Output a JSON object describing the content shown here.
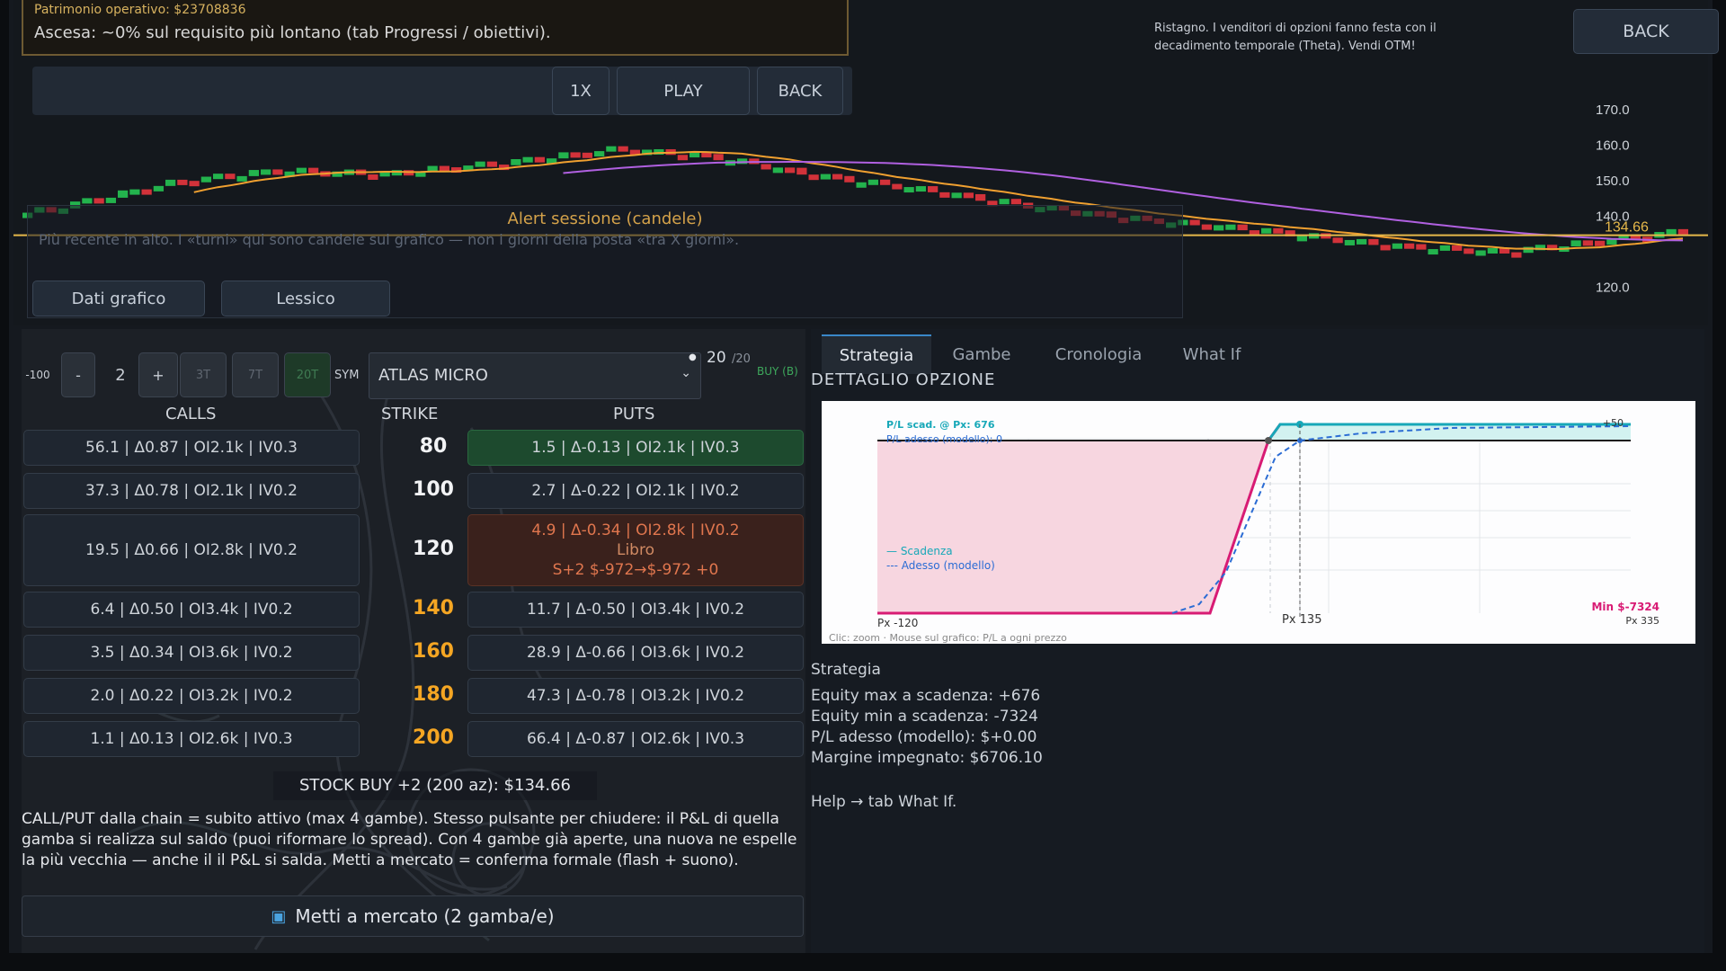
{
  "hud": {
    "patrimonio": "Patrimonio operativo: $23708836",
    "ascesa": "Ascesa: ~0% sul requisito più lontano (tab Progressi / obiettivi)."
  },
  "controls": {
    "speed": "1X",
    "play": "PLAY",
    "back": "BACK",
    "back_top": "BACK"
  },
  "note": "Ristagno. I venditori di opzioni fanno festa con il decadimento temporale (Theta). Vendi OTM!",
  "alert": {
    "title": "Alert sessione (candele)",
    "subtitle": "Più recente in alto. I «turni» qui sono candele sul grafico — non i giorni della posta «tra X giorni»."
  },
  "buttons": {
    "dati": "Dati grafico",
    "lessico": "Lessico"
  },
  "price_chart": {
    "price_tag": "134.66",
    "yticks": [
      "170.0",
      "160.0",
      "150.0",
      "140.0",
      "120.0"
    ],
    "colors": {
      "up": "#23b34d",
      "down": "#d2323a",
      "ma_fast": "#f0a030",
      "ma_slow": "#b060e0",
      "level": "#e6b84a"
    }
  },
  "options": {
    "stepper": {
      "minus100": "-100",
      "minus": "-",
      "qty": "2",
      "plus": "+",
      "b3t": "3T",
      "b7t": "7T",
      "b20t": "20T"
    },
    "sym_label": "SYM",
    "symbol": "ATLAS MICRO",
    "turns": "20",
    "turns_total": "/20",
    "buy_label": "BUY (B)",
    "headers": {
      "calls": "CALLS",
      "strike": "STRIKE",
      "puts": "PUTS"
    },
    "rows": [
      {
        "call": "56.1 | Δ0.87 | OI2.1k | IV0.3",
        "strike": "80",
        "put": "1.5 | Δ-0.13 | OI2.1k | IV0.3"
      },
      {
        "call": "37.3 | Δ0.78 | OI2.1k | IV0.2",
        "strike": "100",
        "put": "2.7 | Δ-0.22 | OI2.1k | IV0.2"
      },
      {
        "call": "19.5 | Δ0.66 | OI2.8k | IV0.2",
        "strike": "120",
        "put": "4.9 | Δ-0.34 | OI2.8k | IV0.2",
        "put_sub1": "Libro",
        "put_sub2": "S+2  $-972→$-972  +0"
      },
      {
        "call": "6.4 | Δ0.50 | OI3.4k | IV0.2",
        "strike": "140",
        "put": "11.7 | Δ-0.50 | OI3.4k | IV0.2"
      },
      {
        "call": "3.5 | Δ0.34 | OI3.6k | IV0.2",
        "strike": "160",
        "put": "28.9 | Δ-0.66 | OI3.6k | IV0.2"
      },
      {
        "call": "2.0 | Δ0.22 | OI3.2k | IV0.2",
        "strike": "180",
        "put": "47.3 | Δ-0.78 | OI3.2k | IV0.2"
      },
      {
        "call": "1.1 | Δ0.13 | OI2.6k | IV0.3",
        "strike": "200",
        "put": "66.4 | Δ-0.87 | OI2.6k | IV0.3"
      }
    ],
    "stock_buy": "STOCK BUY +2 (200 az): $134.66",
    "help": "CALL/PUT dalla chain = subito attivo (max 4 gambe). Stesso pulsante per chiudere: il P&L di quella gamba si realizza sul saldo (puoi riformare lo spread). Con 4 gambe già aperte, una nuova ne espelle la più vecchia — anche il il P&L si salda. Metti a mercato = conferma formale (flash + suono).",
    "market_button": "Metti a mercato (2 gamba/e)"
  },
  "right": {
    "tabs": [
      "Strategia",
      "Gambe",
      "Cronologia",
      "What If"
    ],
    "section_title": "DETTAGLIO OPZIONE",
    "payoff": {
      "pl_scad": "P/L scad. @ Px: 676",
      "pl_adesso": "P/L adesso (modello): 0",
      "legend_scad": "— Scadenza",
      "legend_adesso": "--- Adesso (modello)",
      "px_left": "Px -120",
      "px_mid": "Px 135",
      "px_right": "Px 335",
      "min_label": "Min $-7324",
      "max_label": "+50",
      "caption": "Clic: zoom · Mouse sul grafico: P/L a ogni prezzo"
    },
    "stats": {
      "title": "Strategia",
      "eq_max": "Equity max a scadenza: +676",
      "eq_min": "Equity min a scadenza: -7324",
      "pl_now": "P/L adesso (modello): $+0.00",
      "margin": "Margine impegnato: $6706.10",
      "help": "Help → tab What If."
    }
  }
}
